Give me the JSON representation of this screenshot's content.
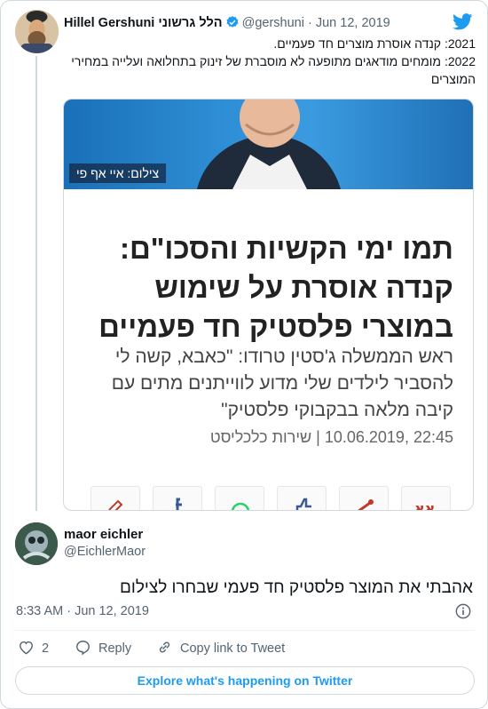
{
  "parent_tweet": {
    "author_name": "Hillel Gershuni הלל גרשוני",
    "handle": "@gershuni",
    "separator": "·",
    "date": "Jun 12, 2019",
    "text_lines": [
      "2021: קנדה אוסרת מוצרים חד פעמיים.",
      "2022: מומחים מודאגים מתופעה לא מוסברת של זינוק בתחלואה ועלייה במחירי",
      "המוצרים"
    ],
    "article": {
      "photo_credit": "צילום: איי אף פי",
      "headline_lines": [
        "תמו ימי הקשיות והסכו\"ם:",
        "קנדה אוסרת על שימוש",
        "במוצרי פלסטיק חד פעמיים"
      ],
      "subline_lines": [
        "ראש הממשלה ג'סטין טרודו: \"כאבא, קשה לי",
        "להסביר לילדים שלי מדוע לווייתנים מתים עם",
        "קיבה מלאה בבקבוקי פלסטיק\""
      ],
      "meta": "22:45 ,10.06.2019 | שירות כלכליסט"
    }
  },
  "reply": {
    "author_name": "maor eichler",
    "handle": "@EichlerMaor",
    "text": "אהבתי את המוצר פלסטיק חד פעמי שבחרו לצילום",
    "timestamp": "8:33 AM · Jun 12, 2019",
    "actions": {
      "like_count": "2",
      "reply_label": "Reply",
      "copy_link_label": "Copy link to Tweet"
    }
  },
  "explore_label": "Explore what's happening on Twitter",
  "colors": {
    "accent": "#1d9bf0",
    "secondary_text": "#536471",
    "border": "#cfd9de"
  }
}
